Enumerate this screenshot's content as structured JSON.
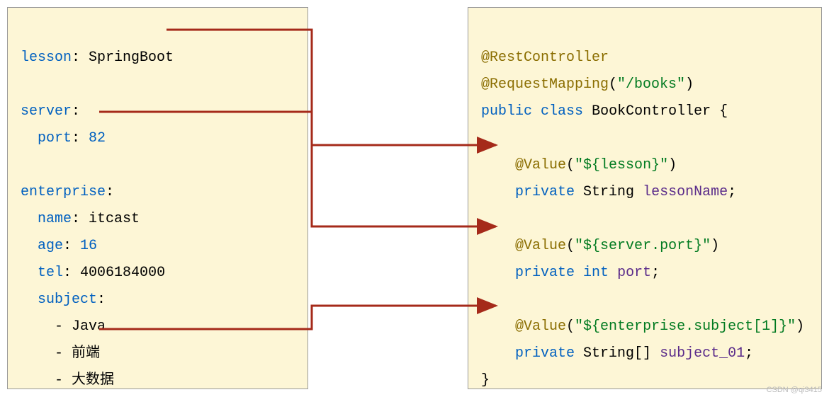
{
  "yaml": {
    "lesson_key": "lesson",
    "lesson_val": "SpringBoot",
    "server_key": "server",
    "port_key": "port",
    "port_val": "82",
    "enterprise_key": "enterprise",
    "name_key": "name",
    "name_val": "itcast",
    "age_key": "age",
    "age_val": "16",
    "tel_key": "tel",
    "tel_val": "4006184000",
    "subject_key": "subject",
    "subject_items": [
      "Java",
      "前端",
      "大数据"
    ]
  },
  "java": {
    "ann_rest": "@RestController",
    "ann_reqmap": "@RequestMapping",
    "reqmap_arg": "\"/books\"",
    "kw_public": "public",
    "kw_class": "class",
    "class_name": "BookController",
    "brace_open": "{",
    "brace_close": "}",
    "ann_value": "@Value",
    "value1_arg": "\"${lesson}\"",
    "value2_arg": "\"${server.port}\"",
    "value3_arg": "\"${enterprise.subject[1]}\"",
    "kw_private": "private",
    "type_string": "String",
    "type_int": "int",
    "type_string_arr": "String[]",
    "field1": "lessonName",
    "field2": "port",
    "field3": "subject_01",
    "semi": ";"
  },
  "watermark": "CSDN @qi3415"
}
